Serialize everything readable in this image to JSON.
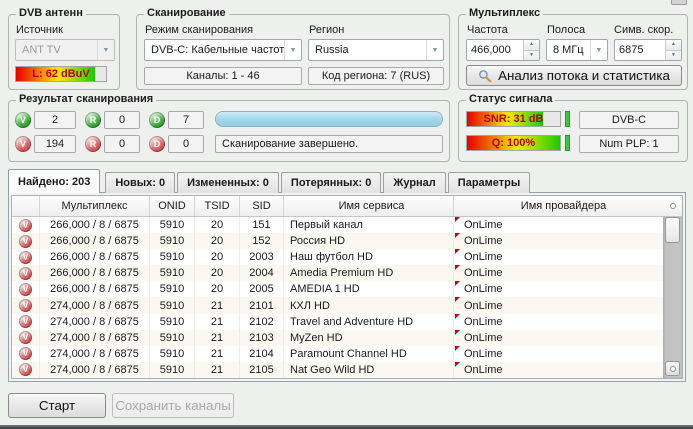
{
  "antenna": {
    "title": "DVB антенн",
    "source_label": "Источник",
    "source_value": "ANT TV",
    "level_text": "L: 62 dBuV",
    "level_fill_pct": 88
  },
  "scan": {
    "title": "Сканирование",
    "mode_label": "Режим сканирования",
    "mode_value": "DVB-C: Кабельные частоты",
    "region_label": "Регион",
    "region_value": "Russia",
    "channels_text": "Каналы: 1 - 46",
    "region_code_text": "Код региона: 7 (RUS)"
  },
  "mux": {
    "title": "Мультиплекс",
    "freq_label": "Частота",
    "freq_value": "466,000",
    "band_label": "Полоса",
    "band_value": "8 МГц",
    "sym_label": "Симв. скор.",
    "sym_value": "6875",
    "analyze_label": "Анализ потока и статистика"
  },
  "scan_result": {
    "title": "Результат сканирования",
    "icons": {
      "v": "V",
      "r": "R",
      "d": "D"
    },
    "rows": [
      {
        "v": "2",
        "r": "0",
        "d": "7"
      },
      {
        "v": "194",
        "r": "0",
        "d": "0"
      }
    ],
    "progress_pct": 100,
    "status_text": "Сканирование завершено."
  },
  "signal": {
    "title": "Статус сигнала",
    "snr_text": "SNR: 31 dB",
    "snr_fill_pct": 82,
    "q_text": "Q: 100%",
    "q_fill_pct": 100,
    "standard_text": "DVB-C",
    "plp_text": "Num PLP: 1"
  },
  "tabs": [
    {
      "label": "Найдено: 203",
      "active": true
    },
    {
      "label": "Новых: 0",
      "active": false
    },
    {
      "label": "Измененных: 0",
      "active": false
    },
    {
      "label": "Потерянных: 0",
      "active": false
    },
    {
      "label": "Журнал",
      "active": false
    },
    {
      "label": "Параметры",
      "active": false
    }
  ],
  "table": {
    "columns": [
      "",
      "Мультиплекс",
      "ONID",
      "TSID",
      "SID",
      "Имя сервиса",
      "Имя провайдера"
    ],
    "row_icon": "V",
    "rows": [
      [
        "266,000 / 8 / 6875",
        "5910",
        "20",
        "151",
        "Первый канал",
        "OnLime"
      ],
      [
        "266,000 / 8 / 6875",
        "5910",
        "20",
        "152",
        "Россия HD",
        "OnLime"
      ],
      [
        "266,000 / 8 / 6875",
        "5910",
        "20",
        "2003",
        "Наш футбол HD",
        "OnLime"
      ],
      [
        "266,000 / 8 / 6875",
        "5910",
        "20",
        "2004",
        "Amedia Premium HD",
        "OnLime"
      ],
      [
        "266,000 / 8 / 6875",
        "5910",
        "20",
        "2005",
        "AMEDIA 1 HD",
        "OnLime"
      ],
      [
        "274,000 / 8 / 6875",
        "5910",
        "21",
        "2101",
        "КХЛ HD",
        "OnLime"
      ],
      [
        "274,000 / 8 / 6875",
        "5910",
        "21",
        "2102",
        "Travel and Adventure HD",
        "OnLime"
      ],
      [
        "274,000 / 8 / 6875",
        "5910",
        "21",
        "2103",
        "MyZen HD",
        "OnLime"
      ],
      [
        "274,000 / 8 / 6875",
        "5910",
        "21",
        "2104",
        "Paramount Channel HD",
        "OnLime"
      ],
      [
        "274,000 / 8 / 6875",
        "5910",
        "21",
        "2105",
        "Nat Geo Wild HD",
        "OnLime"
      ]
    ]
  },
  "footer": {
    "start_label": "Старт",
    "save_label": "Сохранить каналы"
  },
  "colors": {
    "level_gradient_start": "#e80000",
    "level_gradient_mid": "#ffe600",
    "level_gradient_end": "#16cc00",
    "progress_fill": "#a3d6ea",
    "ball_green": "#2f9e2f",
    "ball_red": "#cf5050",
    "modified_marker": "#cc0000",
    "bar_text": "#b40000"
  }
}
